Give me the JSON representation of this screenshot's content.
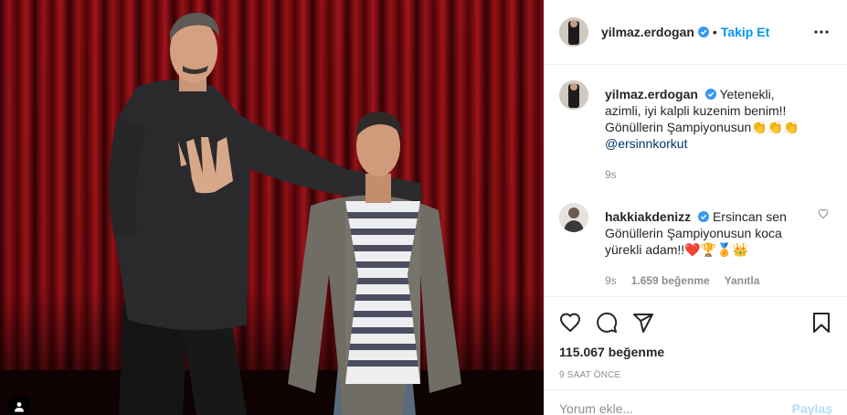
{
  "post": {
    "photo_alt": "",
    "tag_icon": "user-tag-icon"
  },
  "header": {
    "username": "yilmaz.erdogan",
    "verified": true,
    "separator": "•",
    "follow_label": "Takip Et",
    "more_icon": "more-options-icon"
  },
  "caption": {
    "username": "yilmaz.erdogan",
    "text": "Yetenekli, azimli, iyi kalpli kuzenim benim!! Gönüllerin Şampiyonusun👏👏👏",
    "mention": "@ersinnkorkut",
    "time": "9s"
  },
  "comments": [
    {
      "username": "hakkiakdenizz",
      "text": "Ersincan sen Gönüllerin Şampiyonusun koca yürekli adam!!❤️🏆🏅👑",
      "time": "9s",
      "likes": "1.659 beğenme",
      "reply": "Yanıtla"
    }
  ],
  "actions": {
    "like_icon": "heart-icon",
    "comment_icon": "comment-icon",
    "share_icon": "share-icon",
    "save_icon": "bookmark-icon",
    "likes_count": "115.067 beğenme",
    "timestamp": "9 SAAT ÖNCE"
  },
  "add_comment": {
    "placeholder": "Yorum ekle...",
    "post_label": "Paylaş"
  },
  "colors": {
    "accent": "#0095f6",
    "verified": "#3897f0",
    "muted": "#8e8e8e",
    "curtain": "#8b0a10"
  }
}
